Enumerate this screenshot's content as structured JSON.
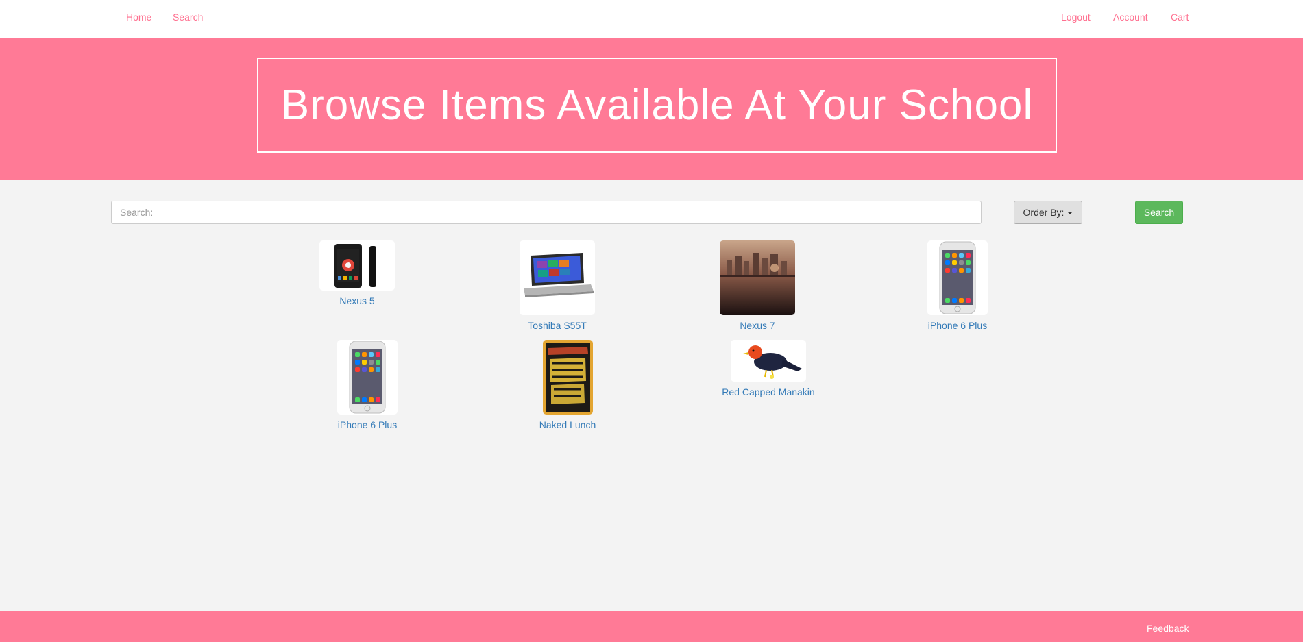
{
  "nav": {
    "home": "Home",
    "search": "Search",
    "logout": "Logout",
    "account": "Account",
    "cart": "Cart"
  },
  "hero": {
    "title": "Browse Items Available At Your School"
  },
  "controls": {
    "search_placeholder": "Search:",
    "order_by_label": "Order By:",
    "search_button": "Search"
  },
  "items": [
    {
      "name": "Nexus 5",
      "image": "phone-image"
    },
    {
      "name": "Toshiba S55T",
      "image": "laptop-image"
    },
    {
      "name": "Nexus 7",
      "image": "tablet-scene-image"
    },
    {
      "name": "iPhone 6 Plus",
      "image": "iphone-image"
    },
    {
      "name": "iPhone 6 Plus",
      "image": "iphone-image"
    },
    {
      "name": "Naked Lunch",
      "image": "book-cover-image"
    },
    {
      "name": "Red Capped Manakin",
      "image": "bird-image"
    }
  ],
  "footer": {
    "feedback": "Feedback"
  },
  "colors": {
    "brand_pink": "#ff7a96",
    "nav_link": "#ff6f8f",
    "item_link": "#337ab7",
    "search_button": "#5cb85c"
  }
}
